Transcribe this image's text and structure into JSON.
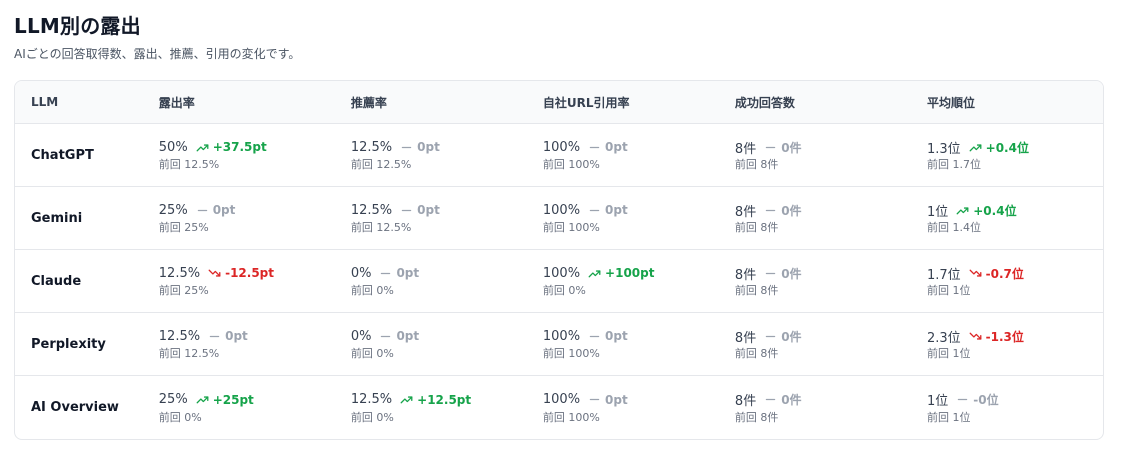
{
  "title": "LLM別の露出",
  "subtitle": "AIごとの回答取得数、露出、推薦、引用の変化です。",
  "headers": [
    "LLM",
    "露出率",
    "推薦率",
    "自社URL引用率",
    "成功回答数",
    "平均順位"
  ],
  "rows": [
    {
      "llm": "ChatGPT",
      "cells": [
        {
          "value": "50%",
          "delta": "+37.5pt",
          "trend": "up",
          "prev": "前回 12.5%"
        },
        {
          "value": "12.5%",
          "delta": "0pt",
          "trend": "flat",
          "prev": "前回 12.5%"
        },
        {
          "value": "100%",
          "delta": "0pt",
          "trend": "flat",
          "prev": "前回 100%"
        },
        {
          "value": "8件",
          "delta": "0件",
          "trend": "flat",
          "prev": "前回 8件"
        },
        {
          "value": "1.3位",
          "delta": "+0.4位",
          "trend": "up",
          "prev": "前回 1.7位"
        }
      ]
    },
    {
      "llm": "Gemini",
      "cells": [
        {
          "value": "25%",
          "delta": "0pt",
          "trend": "flat",
          "prev": "前回 25%"
        },
        {
          "value": "12.5%",
          "delta": "0pt",
          "trend": "flat",
          "prev": "前回 12.5%"
        },
        {
          "value": "100%",
          "delta": "0pt",
          "trend": "flat",
          "prev": "前回 100%"
        },
        {
          "value": "8件",
          "delta": "0件",
          "trend": "flat",
          "prev": "前回 8件"
        },
        {
          "value": "1位",
          "delta": "+0.4位",
          "trend": "up",
          "prev": "前回 1.4位"
        }
      ]
    },
    {
      "llm": "Claude",
      "cells": [
        {
          "value": "12.5%",
          "delta": "-12.5pt",
          "trend": "down",
          "prev": "前回 25%"
        },
        {
          "value": "0%",
          "delta": "0pt",
          "trend": "flat",
          "prev": "前回 0%"
        },
        {
          "value": "100%",
          "delta": "+100pt",
          "trend": "up",
          "prev": "前回 0%"
        },
        {
          "value": "8件",
          "delta": "0件",
          "trend": "flat",
          "prev": "前回 8件"
        },
        {
          "value": "1.7位",
          "delta": "-0.7位",
          "trend": "down",
          "prev": "前回 1位"
        }
      ]
    },
    {
      "llm": "Perplexity",
      "cells": [
        {
          "value": "12.5%",
          "delta": "0pt",
          "trend": "flat",
          "prev": "前回 12.5%"
        },
        {
          "value": "0%",
          "delta": "0pt",
          "trend": "flat",
          "prev": "前回 0%"
        },
        {
          "value": "100%",
          "delta": "0pt",
          "trend": "flat",
          "prev": "前回 100%"
        },
        {
          "value": "8件",
          "delta": "0件",
          "trend": "flat",
          "prev": "前回 8件"
        },
        {
          "value": "2.3位",
          "delta": "-1.3位",
          "trend": "down",
          "prev": "前回 1位"
        }
      ]
    },
    {
      "llm": "AI Overview",
      "cells": [
        {
          "value": "25%",
          "delta": "+25pt",
          "trend": "up",
          "prev": "前回 0%"
        },
        {
          "value": "12.5%",
          "delta": "+12.5pt",
          "trend": "up",
          "prev": "前回 0%"
        },
        {
          "value": "100%",
          "delta": "0pt",
          "trend": "flat",
          "prev": "前回 100%"
        },
        {
          "value": "8件",
          "delta": "0件",
          "trend": "flat",
          "prev": "前回 8件"
        },
        {
          "value": "1位",
          "delta": "-0位",
          "trend": "flat",
          "prev": "前回 1位"
        }
      ]
    }
  ],
  "colors": {
    "up": "#16a34a",
    "down": "#dc2626",
    "flat": "#9ca3af"
  },
  "icons": {
    "up": "trend-up-icon",
    "down": "trend-down-icon",
    "flat": "dash-icon"
  }
}
